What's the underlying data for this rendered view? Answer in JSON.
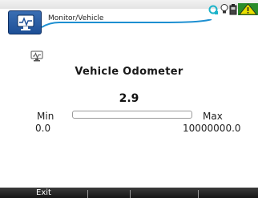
{
  "header": {
    "breadcrumb": "Monitor/Vehicle",
    "app_icon": "monitor-icon",
    "status_icons": [
      "refresh-icon",
      "lightbulb-icon",
      "battery-icon",
      "warning-icon"
    ],
    "accent_color": "#1d8fd1",
    "warning_color": "#e8e000"
  },
  "main": {
    "title": "Vehicle Odometer",
    "value": "2.9",
    "min_label": "Min",
    "min_value": "0.0",
    "max_label": "Max",
    "max_value": "10000000.0",
    "progress_fraction": 0.0,
    "section_icon": "monitor-small-icon"
  },
  "softkeys": {
    "exit_label": "Exit"
  }
}
